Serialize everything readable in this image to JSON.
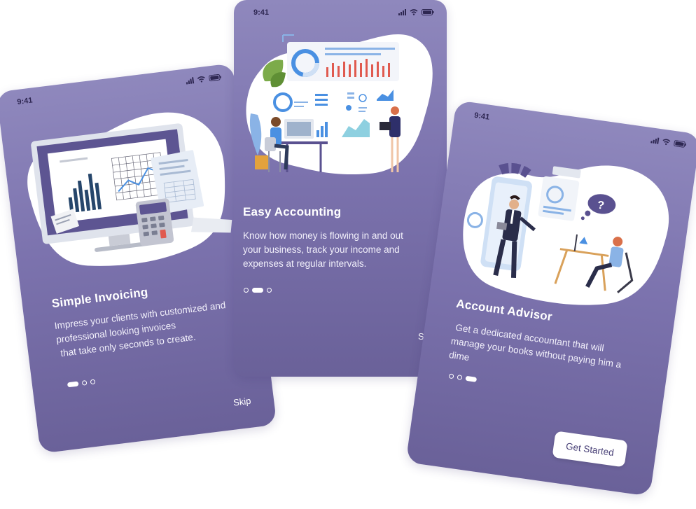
{
  "status_bar": {
    "time": "9:41"
  },
  "screens": [
    {
      "title": "Simple Invoicing",
      "description": "Impress your clients with customized and professional looking invoices that take only seconds to create.",
      "description_lines": [
        "Impress your clients with customized and",
        "professional looking invoices",
        " that take only seconds to create."
      ],
      "pager": {
        "total": 3,
        "active": 1
      },
      "skip_label": "Skip",
      "illustration": "invoice-desktop-illustration"
    },
    {
      "title": "Easy Accounting",
      "description": "Know how money is flowing in and out your business, track your income and expenses at regular intervals.",
      "description_lines": [
        "Know how money is flowing in and out",
        "your business, track your income and",
        "expenses at regular intervals."
      ],
      "pager": {
        "total": 3,
        "active": 2
      },
      "skip_label": "Skip",
      "illustration": "accounting-dashboard-illustration"
    },
    {
      "title": "Account Advisor",
      "description": "Get a dedicated accountant that will manage your books without paying him a dime",
      "description_lines": [
        " Get a dedicated accountant that will",
        "manage your books without paying him a",
        "dime"
      ],
      "pager": {
        "total": 3,
        "active": 3
      },
      "cta_label": "Get Started",
      "illustration": "advisor-meeting-illustration"
    }
  ],
  "colors": {
    "phone_gradient_top": "#8f88bd",
    "phone_gradient_bottom": "#6a6199",
    "blob": "#ffffff",
    "accent_blue": "#4a90e2",
    "accent_red": "#e05a4f",
    "accent_purple": "#5a5190",
    "text": "#ffffff"
  },
  "icons": [
    "signal-icon",
    "wifi-icon",
    "battery-icon"
  ]
}
